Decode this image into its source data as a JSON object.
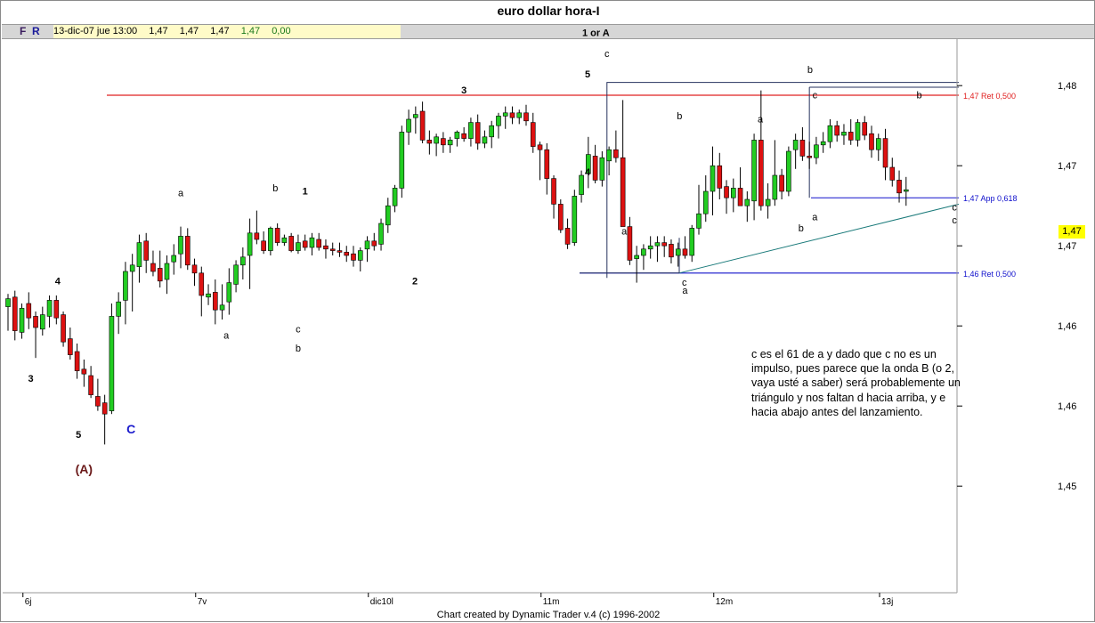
{
  "window": {
    "title": "euro dollar hora-I"
  },
  "toolbar": {
    "buttons": [
      {
        "label": "F"
      },
      {
        "label": "R"
      }
    ],
    "info": {
      "date": "13-dic-07 jue 13:00",
      "open": "1,47",
      "high": "1,47",
      "low": "1,47",
      "close": "1,47",
      "change": "0,00"
    }
  },
  "footer": {
    "credit": "Chart created by Dynamic Trader v.4  (c) 1996-2002"
  },
  "annotation": {
    "text": "c es el 61 de a y dado que c no es un impulso, pues parece que la onda B (o 2, vaya usté a saber) será probablemente un triángulo y nos faltan d hacia arriba, y e hacia abajo antes del lanzamiento."
  },
  "current_price": "1,47",
  "colors": {
    "up": "#22cc22",
    "down": "#dd1111",
    "ret_red": "#e02020",
    "ret_blue": "#1010cc",
    "trend": "#1a7a7a"
  },
  "chart_data": {
    "type": "candlestick",
    "title": "euro dollar hora-I",
    "x_tick_labels": [
      "6j",
      "7v",
      "dic10l",
      "11m",
      "12m",
      "13j"
    ],
    "y_tick_labels": [
      "1,48",
      "1,47",
      "1,47",
      "1,46",
      "1,46",
      "1,45"
    ],
    "ylim": [
      1.4484,
      1.4829
    ],
    "y_ticks": [
      1.48,
      1.475,
      1.47,
      1.465,
      1.46,
      1.455
    ],
    "grid": false,
    "candles": [
      {
        "o": 1.4662,
        "h": 1.467,
        "l": 1.4647,
        "c": 1.4667
      },
      {
        "o": 1.4668,
        "h": 1.4672,
        "l": 1.4641,
        "c": 1.4647
      },
      {
        "o": 1.4646,
        "h": 1.4664,
        "l": 1.4642,
        "c": 1.4661
      },
      {
        "o": 1.4664,
        "h": 1.4671,
        "l": 1.4648,
        "c": 1.4655
      },
      {
        "o": 1.4656,
        "h": 1.4659,
        "l": 1.463,
        "c": 1.4649
      },
      {
        "o": 1.4648,
        "h": 1.4662,
        "l": 1.4644,
        "c": 1.4657
      },
      {
        "o": 1.4656,
        "h": 1.4669,
        "l": 1.4649,
        "c": 1.4666
      },
      {
        "o": 1.4666,
        "h": 1.4669,
        "l": 1.4651,
        "c": 1.4655
      },
      {
        "o": 1.4657,
        "h": 1.4659,
        "l": 1.4637,
        "c": 1.464
      },
      {
        "o": 1.4642,
        "h": 1.4649,
        "l": 1.4629,
        "c": 1.4632
      },
      {
        "o": 1.4634,
        "h": 1.4639,
        "l": 1.4617,
        "c": 1.4622
      },
      {
        "o": 1.4623,
        "h": 1.4629,
        "l": 1.4612,
        "c": 1.462
      },
      {
        "o": 1.4619,
        "h": 1.4625,
        "l": 1.4605,
        "c": 1.4607
      },
      {
        "o": 1.4606,
        "h": 1.4617,
        "l": 1.4597,
        "c": 1.46
      },
      {
        "o": 1.4602,
        "h": 1.4607,
        "l": 1.4576,
        "c": 1.4595
      },
      {
        "o": 1.4597,
        "h": 1.4664,
        "l": 1.4595,
        "c": 1.4656
      },
      {
        "o": 1.4656,
        "h": 1.4671,
        "l": 1.4645,
        "c": 1.4665
      },
      {
        "o": 1.4666,
        "h": 1.469,
        "l": 1.4651,
        "c": 1.4684
      },
      {
        "o": 1.4684,
        "h": 1.4695,
        "l": 1.4659,
        "c": 1.4688
      },
      {
        "o": 1.4687,
        "h": 1.4707,
        "l": 1.4677,
        "c": 1.4702
      },
      {
        "o": 1.4703,
        "h": 1.4708,
        "l": 1.4683,
        "c": 1.4691
      },
      {
        "o": 1.4689,
        "h": 1.4697,
        "l": 1.4681,
        "c": 1.4684
      },
      {
        "o": 1.4686,
        "h": 1.4697,
        "l": 1.4674,
        "c": 1.4678
      },
      {
        "o": 1.4679,
        "h": 1.4694,
        "l": 1.467,
        "c": 1.4689
      },
      {
        "o": 1.469,
        "h": 1.4701,
        "l": 1.4682,
        "c": 1.4694
      },
      {
        "o": 1.4695,
        "h": 1.4712,
        "l": 1.4686,
        "c": 1.4706
      },
      {
        "o": 1.4706,
        "h": 1.4711,
        "l": 1.4685,
        "c": 1.4688
      },
      {
        "o": 1.4688,
        "h": 1.4692,
        "l": 1.4675,
        "c": 1.4683
      },
      {
        "o": 1.4683,
        "h": 1.4687,
        "l": 1.4656,
        "c": 1.4669
      },
      {
        "o": 1.4668,
        "h": 1.4676,
        "l": 1.4663,
        "c": 1.467
      },
      {
        "o": 1.4671,
        "h": 1.4679,
        "l": 1.4651,
        "c": 1.466
      },
      {
        "o": 1.466,
        "h": 1.4676,
        "l": 1.4654,
        "c": 1.4663
      },
      {
        "o": 1.4665,
        "h": 1.4686,
        "l": 1.4657,
        "c": 1.4677
      },
      {
        "o": 1.4676,
        "h": 1.4691,
        "l": 1.4671,
        "c": 1.4688
      },
      {
        "o": 1.4688,
        "h": 1.4699,
        "l": 1.4679,
        "c": 1.4693
      },
      {
        "o": 1.4694,
        "h": 1.4717,
        "l": 1.4673,
        "c": 1.4708
      },
      {
        "o": 1.4708,
        "h": 1.4722,
        "l": 1.4701,
        "c": 1.4704
      },
      {
        "o": 1.4703,
        "h": 1.4709,
        "l": 1.4695,
        "c": 1.4697
      },
      {
        "o": 1.4697,
        "h": 1.4712,
        "l": 1.4694,
        "c": 1.4711
      },
      {
        "o": 1.4711,
        "h": 1.4714,
        "l": 1.47,
        "c": 1.4702
      },
      {
        "o": 1.4702,
        "h": 1.4707,
        "l": 1.47,
        "c": 1.4705
      },
      {
        "o": 1.4706,
        "h": 1.4708,
        "l": 1.4696,
        "c": 1.4697
      },
      {
        "o": 1.4697,
        "h": 1.4707,
        "l": 1.4695,
        "c": 1.4702
      },
      {
        "o": 1.4703,
        "h": 1.4707,
        "l": 1.4697,
        "c": 1.4699
      },
      {
        "o": 1.4699,
        "h": 1.4708,
        "l": 1.4694,
        "c": 1.4705
      },
      {
        "o": 1.4704,
        "h": 1.4708,
        "l": 1.4697,
        "c": 1.4699
      },
      {
        "o": 1.47,
        "h": 1.4704,
        "l": 1.4692,
        "c": 1.4698
      },
      {
        "o": 1.4698,
        "h": 1.4702,
        "l": 1.4694,
        "c": 1.4697
      },
      {
        "o": 1.4697,
        "h": 1.4702,
        "l": 1.4693,
        "c": 1.4696
      },
      {
        "o": 1.4696,
        "h": 1.47,
        "l": 1.469,
        "c": 1.4694
      },
      {
        "o": 1.4695,
        "h": 1.47,
        "l": 1.4687,
        "c": 1.4691
      },
      {
        "o": 1.4691,
        "h": 1.4699,
        "l": 1.4684,
        "c": 1.4697
      },
      {
        "o": 1.4698,
        "h": 1.4706,
        "l": 1.469,
        "c": 1.4703
      },
      {
        "o": 1.4703,
        "h": 1.4708,
        "l": 1.4697,
        "c": 1.47
      },
      {
        "o": 1.4701,
        "h": 1.4717,
        "l": 1.4697,
        "c": 1.4714
      },
      {
        "o": 1.4713,
        "h": 1.473,
        "l": 1.4708,
        "c": 1.4725
      },
      {
        "o": 1.4725,
        "h": 1.4738,
        "l": 1.4721,
        "c": 1.4736
      },
      {
        "o": 1.4736,
        "h": 1.4775,
        "l": 1.473,
        "c": 1.4771
      },
      {
        "o": 1.4771,
        "h": 1.4785,
        "l": 1.4763,
        "c": 1.4779
      },
      {
        "o": 1.478,
        "h": 1.4787,
        "l": 1.477,
        "c": 1.4782
      },
      {
        "o": 1.4784,
        "h": 1.479,
        "l": 1.4764,
        "c": 1.4766
      },
      {
        "o": 1.4766,
        "h": 1.4772,
        "l": 1.4757,
        "c": 1.4764
      },
      {
        "o": 1.4764,
        "h": 1.477,
        "l": 1.4756,
        "c": 1.4768
      },
      {
        "o": 1.4767,
        "h": 1.4771,
        "l": 1.4758,
        "c": 1.4763
      },
      {
        "o": 1.4763,
        "h": 1.4768,
        "l": 1.4758,
        "c": 1.4766
      },
      {
        "o": 1.4767,
        "h": 1.4772,
        "l": 1.4762,
        "c": 1.4771
      },
      {
        "o": 1.477,
        "h": 1.4774,
        "l": 1.4765,
        "c": 1.4767
      },
      {
        "o": 1.4767,
        "h": 1.478,
        "l": 1.4762,
        "c": 1.4777
      },
      {
        "o": 1.4777,
        "h": 1.4782,
        "l": 1.476,
        "c": 1.4764
      },
      {
        "o": 1.4764,
        "h": 1.4772,
        "l": 1.4761,
        "c": 1.4768
      },
      {
        "o": 1.4768,
        "h": 1.4778,
        "l": 1.4761,
        "c": 1.4775
      },
      {
        "o": 1.4775,
        "h": 1.4783,
        "l": 1.4767,
        "c": 1.4781
      },
      {
        "o": 1.4781,
        "h": 1.4787,
        "l": 1.4773,
        "c": 1.4783
      },
      {
        "o": 1.4783,
        "h": 1.4787,
        "l": 1.4776,
        "c": 1.478
      },
      {
        "o": 1.478,
        "h": 1.4785,
        "l": 1.4776,
        "c": 1.4783
      },
      {
        "o": 1.4783,
        "h": 1.4788,
        "l": 1.4775,
        "c": 1.4778
      },
      {
        "o": 1.4777,
        "h": 1.4783,
        "l": 1.4758,
        "c": 1.4762
      },
      {
        "o": 1.4763,
        "h": 1.4765,
        "l": 1.4741,
        "c": 1.476
      },
      {
        "o": 1.476,
        "h": 1.4764,
        "l": 1.4732,
        "c": 1.4742
      },
      {
        "o": 1.4742,
        "h": 1.4744,
        "l": 1.4717,
        "c": 1.4726
      },
      {
        "o": 1.4726,
        "h": 1.4729,
        "l": 1.4708,
        "c": 1.471
      },
      {
        "o": 1.4711,
        "h": 1.4717,
        "l": 1.4698,
        "c": 1.4701
      },
      {
        "o": 1.4702,
        "h": 1.4735,
        "l": 1.47,
        "c": 1.4731
      },
      {
        "o": 1.4732,
        "h": 1.4747,
        "l": 1.4727,
        "c": 1.4744
      },
      {
        "o": 1.4745,
        "h": 1.4768,
        "l": 1.4736,
        "c": 1.4757
      },
      {
        "o": 1.4756,
        "h": 1.4763,
        "l": 1.4739,
        "c": 1.4741
      },
      {
        "o": 1.4741,
        "h": 1.4759,
        "l": 1.4737,
        "c": 1.4755
      },
      {
        "o": 1.4753,
        "h": 1.4762,
        "l": 1.4744,
        "c": 1.476
      },
      {
        "o": 1.476,
        "h": 1.4772,
        "l": 1.4752,
        "c": 1.4755
      },
      {
        "o": 1.4755,
        "h": 1.4791,
        "l": 1.4748,
        "c": 1.4712
      },
      {
        "o": 1.4712,
        "h": 1.4718,
        "l": 1.4688,
        "c": 1.4691
      },
      {
        "o": 1.4692,
        "h": 1.47,
        "l": 1.4677,
        "c": 1.4694
      },
      {
        "o": 1.4694,
        "h": 1.4701,
        "l": 1.4685,
        "c": 1.4698
      },
      {
        "o": 1.4698,
        "h": 1.4706,
        "l": 1.4692,
        "c": 1.47
      },
      {
        "o": 1.47,
        "h": 1.4706,
        "l": 1.469,
        "c": 1.4702
      },
      {
        "o": 1.4702,
        "h": 1.4706,
        "l": 1.4693,
        "c": 1.47
      },
      {
        "o": 1.4701,
        "h": 1.4704,
        "l": 1.4689,
        "c": 1.4693
      },
      {
        "o": 1.4694,
        "h": 1.4702,
        "l": 1.4687,
        "c": 1.4698
      },
      {
        "o": 1.4698,
        "h": 1.4706,
        "l": 1.4692,
        "c": 1.4694
      },
      {
        "o": 1.4694,
        "h": 1.4713,
        "l": 1.469,
        "c": 1.4711
      },
      {
        "o": 1.4711,
        "h": 1.4738,
        "l": 1.4707,
        "c": 1.472
      },
      {
        "o": 1.472,
        "h": 1.4744,
        "l": 1.4715,
        "c": 1.4734
      },
      {
        "o": 1.4734,
        "h": 1.4762,
        "l": 1.4719,
        "c": 1.475
      },
      {
        "o": 1.475,
        "h": 1.4758,
        "l": 1.4729,
        "c": 1.4736
      },
      {
        "o": 1.4737,
        "h": 1.4741,
        "l": 1.472,
        "c": 1.473
      },
      {
        "o": 1.473,
        "h": 1.4742,
        "l": 1.4721,
        "c": 1.4736
      },
      {
        "o": 1.4736,
        "h": 1.4749,
        "l": 1.4728,
        "c": 1.4725
      },
      {
        "o": 1.4725,
        "h": 1.4734,
        "l": 1.4715,
        "c": 1.4729
      },
      {
        "o": 1.4728,
        "h": 1.477,
        "l": 1.4716,
        "c": 1.4766
      },
      {
        "o": 1.4766,
        "h": 1.4797,
        "l": 1.4722,
        "c": 1.4725
      },
      {
        "o": 1.4725,
        "h": 1.4739,
        "l": 1.4717,
        "c": 1.4729
      },
      {
        "o": 1.4729,
        "h": 1.4766,
        "l": 1.4725,
        "c": 1.4744
      },
      {
        "o": 1.4744,
        "h": 1.4748,
        "l": 1.4729,
        "c": 1.4734
      },
      {
        "o": 1.4734,
        "h": 1.4762,
        "l": 1.4731,
        "c": 1.4759
      },
      {
        "o": 1.476,
        "h": 1.477,
        "l": 1.4748,
        "c": 1.4766
      },
      {
        "o": 1.4766,
        "h": 1.4774,
        "l": 1.4753,
        "c": 1.4756
      },
      {
        "o": 1.4756,
        "h": 1.4765,
        "l": 1.4748,
        "c": 1.4755
      },
      {
        "o": 1.4755,
        "h": 1.4768,
        "l": 1.4751,
        "c": 1.4763
      },
      {
        "o": 1.4763,
        "h": 1.4771,
        "l": 1.4758,
        "c": 1.4765
      },
      {
        "o": 1.4765,
        "h": 1.4779,
        "l": 1.4761,
        "c": 1.4775
      },
      {
        "o": 1.4775,
        "h": 1.4778,
        "l": 1.4765,
        "c": 1.4769
      },
      {
        "o": 1.4769,
        "h": 1.4776,
        "l": 1.4763,
        "c": 1.4771
      },
      {
        "o": 1.4771,
        "h": 1.4779,
        "l": 1.4763,
        "c": 1.4766
      },
      {
        "o": 1.4766,
        "h": 1.4779,
        "l": 1.4762,
        "c": 1.4777
      },
      {
        "o": 1.4777,
        "h": 1.4781,
        "l": 1.4766,
        "c": 1.4769
      },
      {
        "o": 1.477,
        "h": 1.4775,
        "l": 1.4755,
        "c": 1.476
      },
      {
        "o": 1.476,
        "h": 1.477,
        "l": 1.4753,
        "c": 1.4767
      },
      {
        "o": 1.4767,
        "h": 1.4773,
        "l": 1.4741,
        "c": 1.4749
      },
      {
        "o": 1.4749,
        "h": 1.4755,
        "l": 1.4737,
        "c": 1.4741
      },
      {
        "o": 1.4741,
        "h": 1.4747,
        "l": 1.4727,
        "c": 1.4733
      },
      {
        "o": 1.4734,
        "h": 1.4743,
        "l": 1.4725,
        "c": 1.4735
      }
    ],
    "ret_lines": [
      {
        "label": "1,47 Ret 0,500",
        "y": 1.4794,
        "color": "red"
      },
      {
        "label": "1,47 App 0,618",
        "y": 1.473,
        "color": "blue"
      },
      {
        "label": "1,46 Ret 0,500",
        "y": 1.4683,
        "color": "blue"
      }
    ],
    "wave_labels": [
      {
        "text": "1 or A",
        "x": 85.1,
        "y": 1.4831
      },
      {
        "text": "c",
        "x": 86.7,
        "y": 1.4818
      },
      {
        "text": "5",
        "x": 83.9,
        "y": 1.4805
      },
      {
        "text": "3",
        "x": 66.0,
        "y": 1.4795
      },
      {
        "text": "4",
        "x": 83.9,
        "y": 1.4744
      },
      {
        "text": "b",
        "x": 116.1,
        "y": 1.4808
      },
      {
        "text": "c",
        "x": 116.8,
        "y": 1.4792
      },
      {
        "text": "b",
        "x": 131.9,
        "y": 1.4792
      },
      {
        "text": "b",
        "x": 97.2,
        "y": 1.4779
      },
      {
        "text": "a",
        "x": 108.9,
        "y": 1.4777
      },
      {
        "text": "a",
        "x": 89.2,
        "y": 1.4707
      },
      {
        "text": "c",
        "x": 97.9,
        "y": 1.4675
      },
      {
        "text": "a",
        "x": 98.0,
        "y": 1.467
      },
      {
        "text": "b",
        "x": 114.8,
        "y": 1.4709
      },
      {
        "text": "a",
        "x": 116.8,
        "y": 1.4716
      },
      {
        "text": "c",
        "x": 137.0,
        "y": 1.4722
      },
      {
        "text": "c",
        "x": 137.0,
        "y": 1.4714
      },
      {
        "text": "a",
        "x": 25.0,
        "y": 1.4731
      },
      {
        "text": "b",
        "x": 38.7,
        "y": 1.4734
      },
      {
        "text": "1",
        "x": 43.0,
        "y": 1.4732
      },
      {
        "text": "2",
        "x": 58.9,
        "y": 1.4676
      },
      {
        "text": "a",
        "x": 31.6,
        "y": 1.4642
      },
      {
        "text": "c",
        "x": 42.0,
        "y": 1.4646
      },
      {
        "text": "b",
        "x": 42.0,
        "y": 1.4634
      },
      {
        "text": "4",
        "x": 7.2,
        "y": 1.4676
      },
      {
        "text": "3",
        "x": 3.3,
        "y": 1.4615
      },
      {
        "text": "5",
        "x": 10.2,
        "y": 1.458
      },
      {
        "text": "C",
        "x": 17.8,
        "y": 1.4583
      },
      {
        "text": "(A)",
        "x": 11.0,
        "y": 1.4558
      }
    ]
  }
}
